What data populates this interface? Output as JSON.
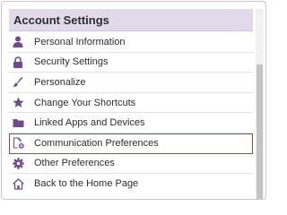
{
  "panel": {
    "title": "Account Settings",
    "items": [
      {
        "label": "Personal Information",
        "icon": "person-icon"
      },
      {
        "label": "Security Settings",
        "icon": "lock-icon"
      },
      {
        "label": "Personalize",
        "icon": "brush-icon"
      },
      {
        "label": "Change Your Shortcuts",
        "icon": "star-icon"
      },
      {
        "label": "Linked Apps and Devices",
        "icon": "folder-icon"
      },
      {
        "label": "Communication Preferences",
        "icon": "document-gear-icon",
        "highlighted": true
      },
      {
        "label": "Other Preferences",
        "icon": "gear-icon"
      },
      {
        "label": "Back to the Home Page",
        "icon": "home-icon"
      }
    ]
  },
  "colors": {
    "header_background": "#e2d9ea",
    "icon": "#6f4a8e",
    "highlight_border": "#c0393b"
  }
}
